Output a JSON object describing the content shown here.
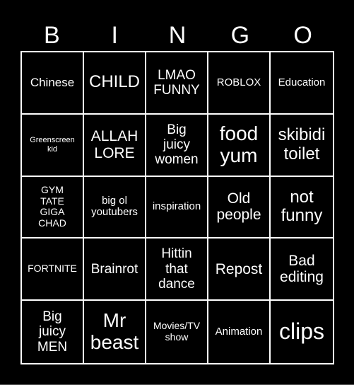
{
  "card": {
    "header": [
      "B",
      "I",
      "N",
      "G",
      "O"
    ],
    "cells": [
      [
        "Chinese",
        "CHILD",
        "LMAO\nFUNNY",
        "ROBLOX",
        "Education"
      ],
      [
        "Greenscreen\nkid",
        "ALLAH\nLORE",
        "Big\njuicy\nwomen",
        "food\nyum",
        "skibidi\ntoilet"
      ],
      [
        "GYM\nTATE\nGIGA\nCHAD",
        "big ol\nyoutubers",
        "inspiration",
        "Old\npeople",
        "not\nfunny"
      ],
      [
        "FORTNITE",
        "Brainrot",
        "Hittin\nthat\ndance",
        "Repost",
        "Bad\nediting"
      ],
      [
        "Big\njuicy\nMEN",
        "Mr\nbeast",
        "Movies/TV\nshow",
        "Animation",
        "clips"
      ]
    ]
  },
  "colors": {
    "background": "#000000",
    "text": "#ffffff",
    "grid_lines": "#ffffff"
  }
}
